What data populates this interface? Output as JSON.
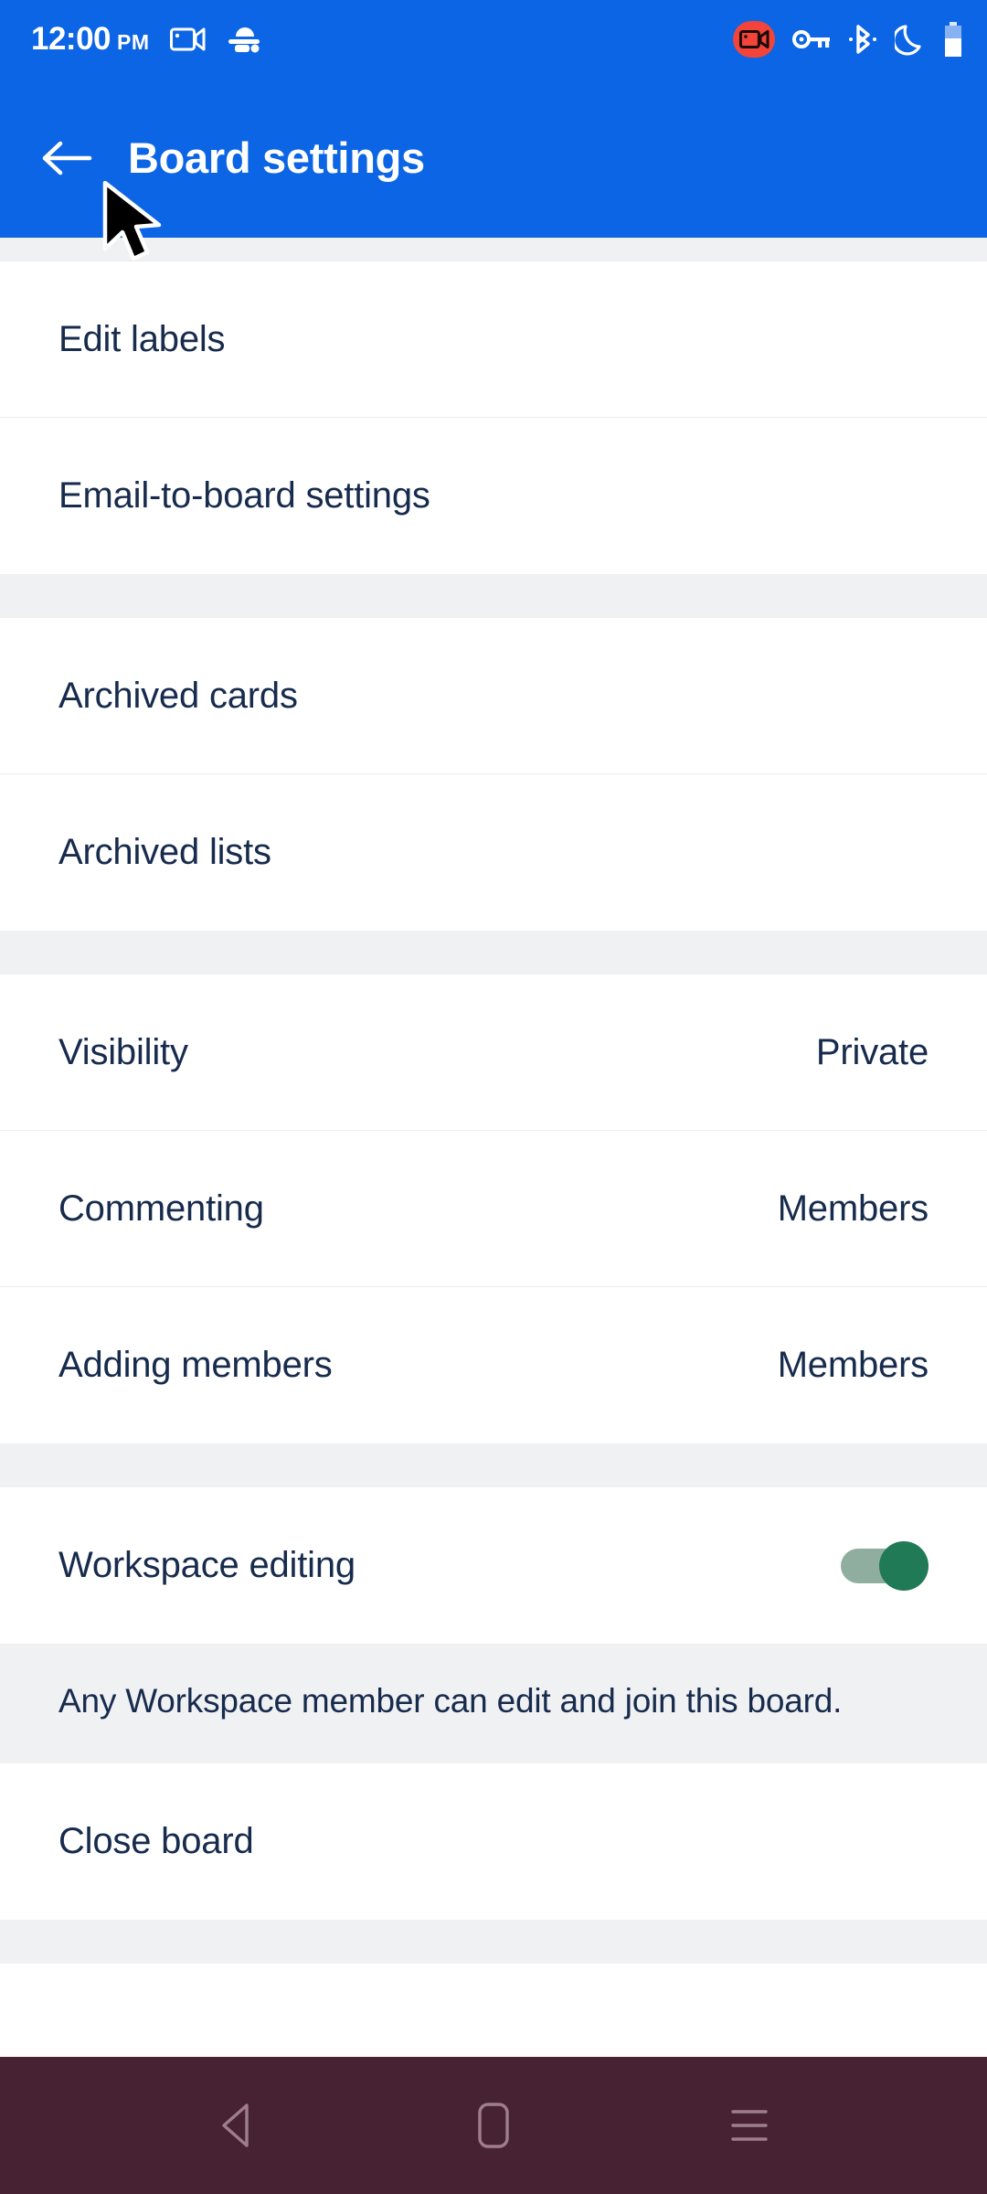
{
  "status_bar": {
    "time": "12:00",
    "ampm": "PM",
    "left_icons": [
      "video-camera-icon",
      "android-debug-icon"
    ],
    "right_icons": [
      "screen-recording-badge-icon",
      "vpn-key-icon",
      "bluetooth-icon",
      "do-not-disturb-moon-icon",
      "battery-icon"
    ],
    "background_color": "#0C65E4"
  },
  "app_bar": {
    "back_label": "back-arrow",
    "title": "Board settings",
    "background_color": "#0C65E4",
    "text_color": "#FFFFFF"
  },
  "settings": {
    "section_1": [
      {
        "label": "Edit labels",
        "value": ""
      },
      {
        "label": "Email-to-board settings",
        "value": ""
      }
    ],
    "section_2": [
      {
        "label": "Archived cards",
        "value": ""
      },
      {
        "label": "Archived lists",
        "value": ""
      }
    ],
    "section_3": [
      {
        "label": "Visibility",
        "value": "Private"
      },
      {
        "label": "Commenting",
        "value": "Members"
      },
      {
        "label": "Adding members",
        "value": "Members"
      }
    ],
    "section_4": {
      "toggle_row": {
        "label": "Workspace editing",
        "toggle_state": "on",
        "toggle_track_color": "#8FAE9F",
        "toggle_thumb_color": "#1F7A55"
      },
      "description": "Any Workspace member can edit and join this board."
    },
    "section_5": [
      {
        "label": "Close board",
        "value": ""
      }
    ]
  },
  "nav_bar": {
    "background_color": "#472232",
    "buttons": [
      "back-triangle-icon",
      "home-square-icon",
      "recents-hamburger-icon"
    ]
  },
  "colors": {
    "row_text": "#172B4D",
    "divider": "#EDEEF0",
    "section_gap": "#F0F1F3",
    "page_background": "#FFFFFF"
  }
}
